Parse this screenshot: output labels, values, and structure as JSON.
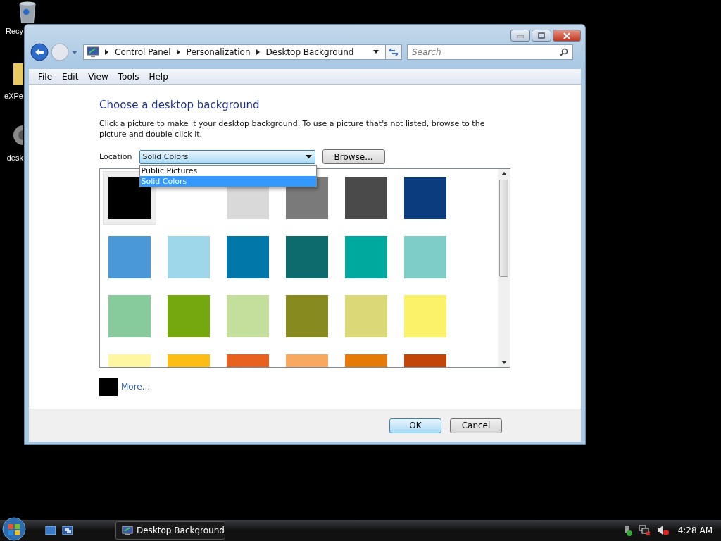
{
  "desktop_icons": [
    {
      "label": "Recy",
      "kind": "bin"
    },
    {
      "label": "eXPe",
      "kind": "folder"
    },
    {
      "label": "desk",
      "kind": "gear"
    }
  ],
  "address_bar": {
    "crumbs": [
      "Control Panel",
      "Personalization",
      "Desktop Background"
    ]
  },
  "search": {
    "placeholder": "Search"
  },
  "menu": [
    "File",
    "Edit",
    "View",
    "Tools",
    "Help"
  ],
  "heading": "Choose a desktop background",
  "description": "Click a picture to make it your desktop background. To use a picture that's not listed, browse to the picture and double click it.",
  "location": {
    "label": "Location",
    "value": "Solid Colors",
    "options": [
      {
        "label": "Public Pictures",
        "selected": false
      },
      {
        "label": "Solid Colors",
        "selected": true
      }
    ]
  },
  "browse_button": "Browse...",
  "swatches": [
    {
      "color": "#000000",
      "selected": true
    },
    {
      "color": "#ffffff",
      "selected": false
    },
    {
      "color": "#d9d9d9",
      "selected": false
    },
    {
      "color": "#7a7a7a",
      "selected": false
    },
    {
      "color": "#4a4a4a",
      "selected": false
    },
    {
      "color": "#0b3c7d",
      "selected": false
    },
    {
      "color": "#4a98d8",
      "selected": false
    },
    {
      "color": "#9ed6ea",
      "selected": false
    },
    {
      "color": "#0077a8",
      "selected": false
    },
    {
      "color": "#0d6b6e",
      "selected": false
    },
    {
      "color": "#00a99d",
      "selected": false
    },
    {
      "color": "#7ecdc8",
      "selected": false
    },
    {
      "color": "#87cb9c",
      "selected": false
    },
    {
      "color": "#74a80e",
      "selected": false
    },
    {
      "color": "#c4de9c",
      "selected": false
    },
    {
      "color": "#878a1e",
      "selected": false
    },
    {
      "color": "#dbd977",
      "selected": false
    },
    {
      "color": "#fbf26a",
      "selected": false
    },
    {
      "color": "#fef6a0",
      "selected": false
    },
    {
      "color": "#fdbd14",
      "selected": false
    },
    {
      "color": "#e8611f",
      "selected": false
    },
    {
      "color": "#f8a95f",
      "selected": false
    },
    {
      "color": "#e57a08",
      "selected": false
    },
    {
      "color": "#c14607",
      "selected": false
    }
  ],
  "more": {
    "color": "#000000",
    "label": "More..."
  },
  "buttons": [
    {
      "label": "OK",
      "kind": "default"
    },
    {
      "label": "Cancel",
      "kind": "normal"
    }
  ],
  "taskbar": {
    "task": "Desktop Background",
    "clock": "4:28 AM"
  }
}
